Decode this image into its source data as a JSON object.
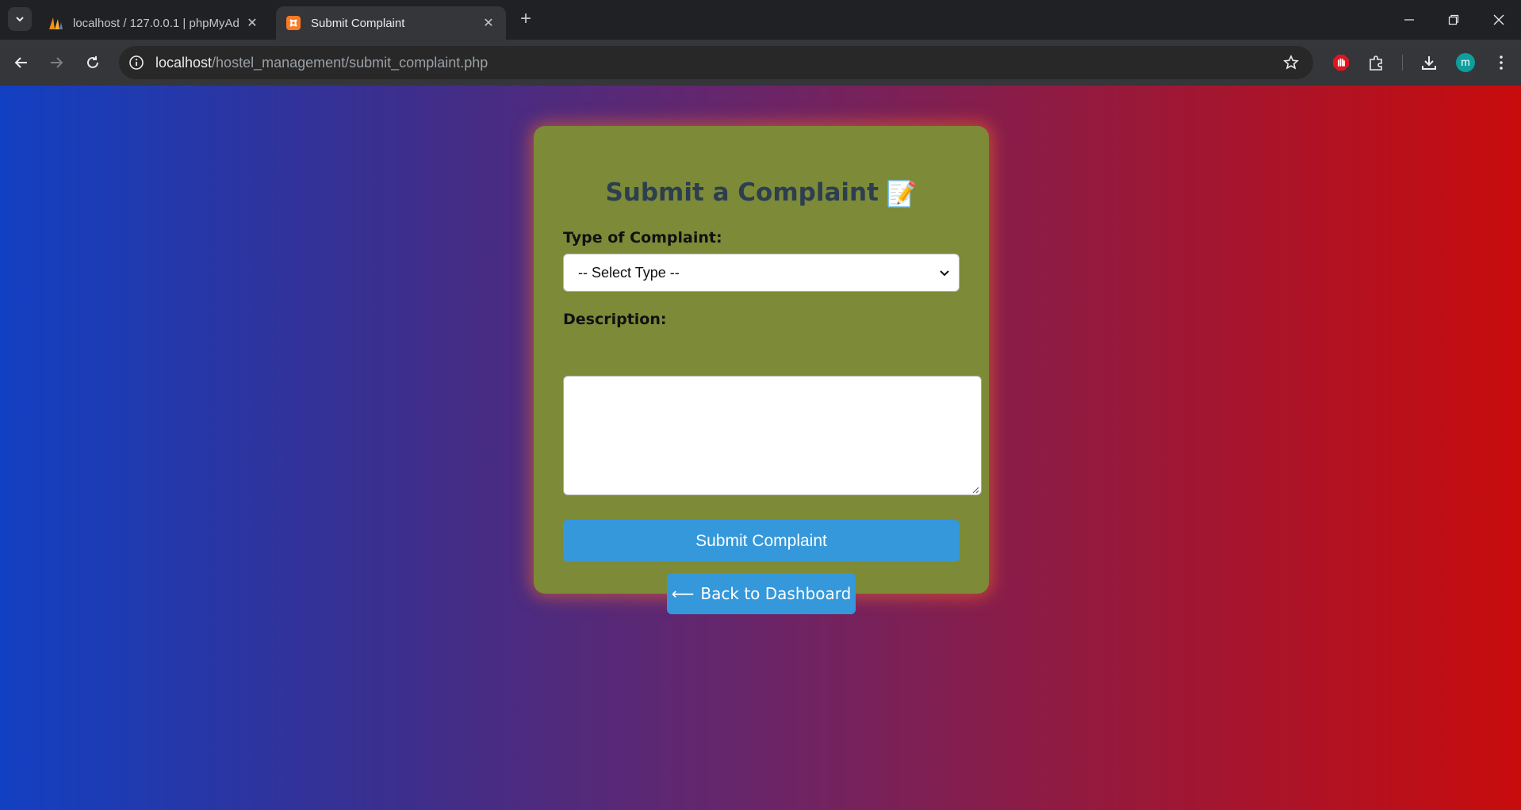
{
  "browser": {
    "tabs": [
      {
        "title": "localhost / 127.0.0.1 | phpMyAd",
        "favicon": "phpmyadmin-icon",
        "active": false
      },
      {
        "title": "Submit Complaint",
        "favicon": "xampp-icon",
        "active": true
      }
    ],
    "url": {
      "host": "localhost",
      "path": "/hostel_management/submit_complaint.php"
    },
    "profile_initial": "m"
  },
  "form": {
    "heading": "Submit a Complaint",
    "heading_emoji": "📝",
    "type_label": "Type of Complaint:",
    "type_selected": "-- Select Type --",
    "description_label": "Description:",
    "description_value": "",
    "submit_label": "Submit Complaint",
    "back_arrow": "⟵",
    "back_label": "Back to Dashboard"
  },
  "colors": {
    "card_bg": "#7d8a38",
    "button_bg": "#3498db",
    "heading": "#2c3e50",
    "gradient_start": "#1240c2",
    "gradient_end": "#c80c0c"
  }
}
